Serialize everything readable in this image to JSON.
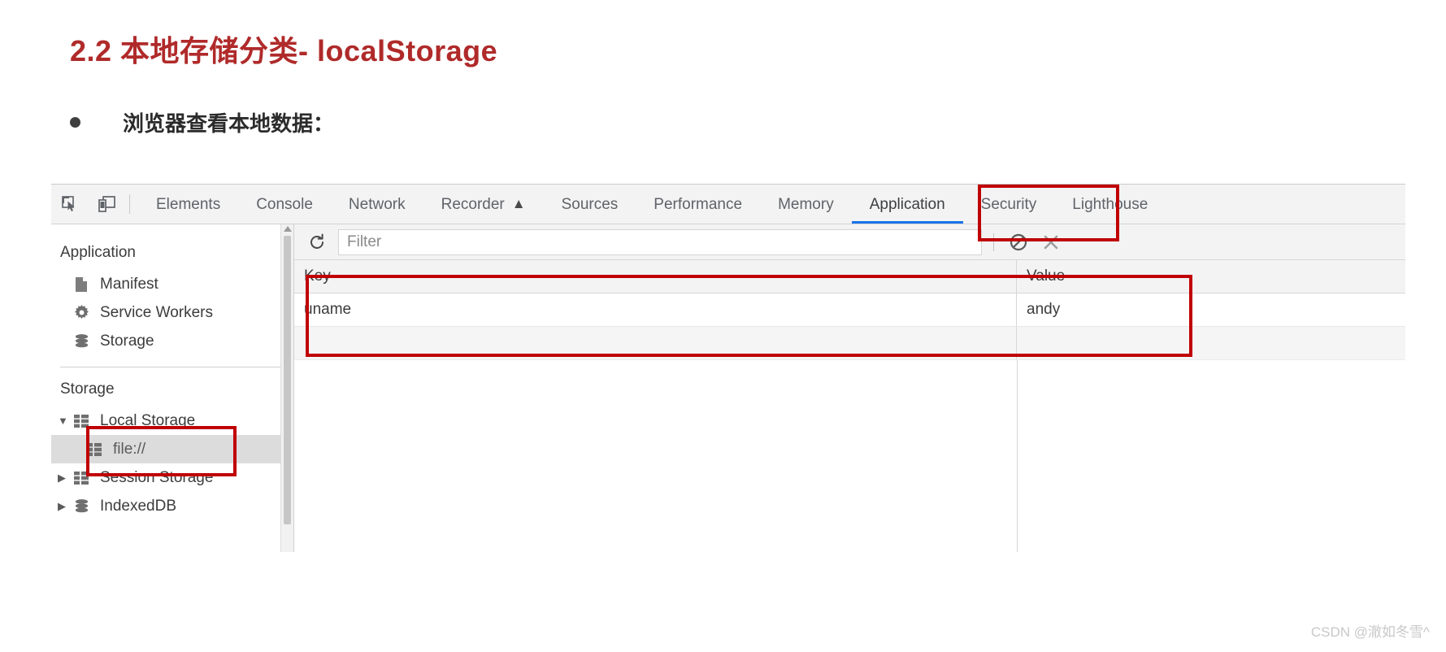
{
  "slide": {
    "title": "2.2 本地存储分类- localStorage",
    "title_color": "#b02a2a",
    "bullet_text": "浏览器查看本地数据：",
    "watermark": "CSDN @澈如冬雪^"
  },
  "devtools": {
    "left_icons": [
      {
        "name": "inspect-element-icon",
        "glyph": "inspect"
      },
      {
        "name": "device-toolbar-icon",
        "glyph": "device"
      }
    ],
    "tabs": [
      {
        "label": "Elements",
        "active": false
      },
      {
        "label": "Console",
        "active": false
      },
      {
        "label": "Network",
        "active": false
      },
      {
        "label": "Recorder",
        "active": false,
        "badge": "▲"
      },
      {
        "label": "Sources",
        "active": false
      },
      {
        "label": "Performance",
        "active": false
      },
      {
        "label": "Memory",
        "active": false
      },
      {
        "label": "Application",
        "active": true
      },
      {
        "label": "Security",
        "active": false
      },
      {
        "label": "Lighthouse",
        "active": false
      }
    ],
    "active_tab": "Application",
    "active_tab_underline_color": "#1a73e8",
    "annotation_color": "#c00000",
    "sidebar": {
      "sections": [
        {
          "title": "Application",
          "items": [
            {
              "label": "Manifest",
              "icon": "document-icon",
              "twisty": "",
              "selected": false
            },
            {
              "label": "Service Workers",
              "icon": "gear-icon",
              "twisty": "",
              "selected": false
            },
            {
              "label": "Storage",
              "icon": "database-icon",
              "twisty": "",
              "selected": false
            }
          ]
        },
        {
          "title": "Storage",
          "items": [
            {
              "label": "Local Storage",
              "icon": "table-icon",
              "twisty": "▼",
              "selected": false
            },
            {
              "label": "file://",
              "icon": "table-icon",
              "twisty": "",
              "selected": true,
              "child": true
            },
            {
              "label": "Session Storage",
              "icon": "table-icon",
              "twisty": "▶",
              "selected": false
            },
            {
              "label": "IndexedDB",
              "icon": "database-icon",
              "twisty": "▶",
              "selected": false,
              "cutoff": true
            }
          ]
        }
      ]
    },
    "toolbar": {
      "refresh_icon": "refresh-icon",
      "filter_placeholder": "Filter",
      "filter_value": "",
      "clear_all_icon": "clear-all-icon",
      "delete_selected_icon": "delete-selected-icon"
    },
    "table": {
      "columns": [
        "Key",
        "Value"
      ],
      "rows": [
        {
          "key": "uname",
          "value": "andy"
        }
      ],
      "empty_rows": 1
    }
  }
}
